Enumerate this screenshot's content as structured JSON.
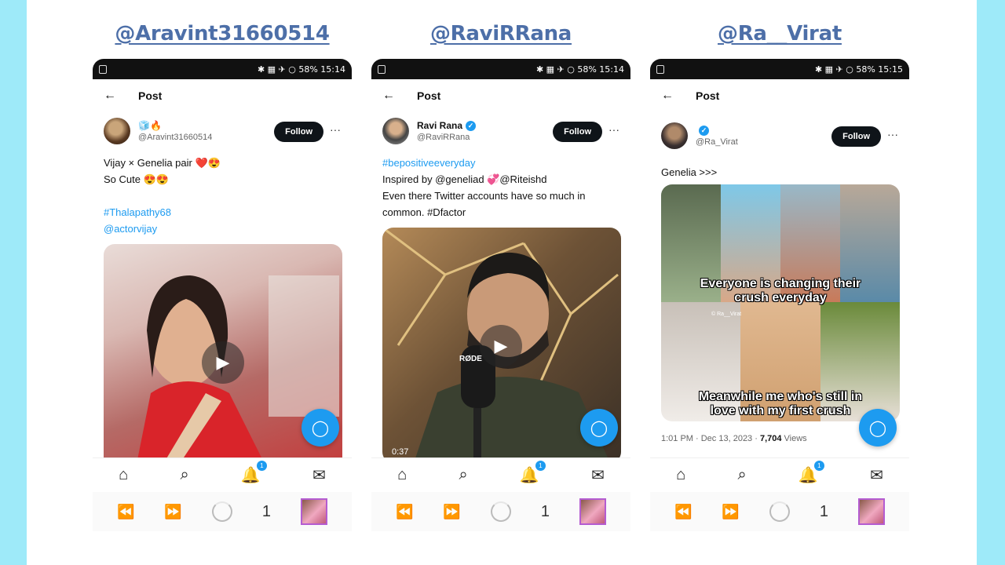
{
  "panels": [
    {
      "handle_title": "@Aravint31660514",
      "status": "✱ ▦ ✈ ○ 58% 15:14",
      "header": {
        "back": "←",
        "title": "Post"
      },
      "user": {
        "name": "🧊🔥",
        "handle": "@Aravint31660514",
        "verified": false
      },
      "follow_label": "Follow",
      "more": "···",
      "tweet_lines": [
        "Vijay × Genelia pair ❤️😍",
        "So Cute 😍😍",
        "",
        "#Thalapathy68",
        "@actorvijay"
      ],
      "nav": {
        "home": "⌂",
        "search": "⌕",
        "notifications": "🔔",
        "notif_count": "1",
        "messages": "✉"
      },
      "sys": {
        "rewind": "⏪",
        "forward": "⏩",
        "page": "1"
      }
    },
    {
      "handle_title": "@RaviRRana",
      "status": "✱ ▦ ✈ ○ 58% 15:14",
      "header": {
        "back": "←",
        "title": "Post"
      },
      "user": {
        "name": "Ravi Rana",
        "handle": "@RaviRRana",
        "verified": true
      },
      "follow_label": "Follow",
      "more": "···",
      "tweet_lines": [
        "#bepositiveeveryday",
        "Inspired by @geneliad 💞@Riteishd",
        "Even there Twitter accounts have so much in",
        "common. #Dfactor"
      ],
      "video_duration": "0:37",
      "mic_label": "RØDE",
      "nav": {
        "home": "⌂",
        "search": "⌕",
        "notifications": "🔔",
        "notif_count": "1",
        "messages": "✉"
      },
      "sys": {
        "rewind": "⏪",
        "forward": "⏩",
        "page": "1"
      }
    },
    {
      "handle_title": "@Ra__Virat",
      "status": "✱ ▦ ✈ ○ 58% 15:15",
      "header": {
        "back": "←",
        "title": "Post"
      },
      "user": {
        "name": "",
        "handle": "@Ra_Virat",
        "verified": true
      },
      "follow_label": "Follow",
      "more": "···",
      "tweet_lines": [
        "Genelia >>>"
      ],
      "meme": {
        "top_caption": [
          "Everyone is changing their",
          "crush everyday"
        ],
        "bottom_caption": [
          "Meanwhile me who's still in",
          "love with my first crush"
        ],
        "watermark": "© Ra__Virat"
      },
      "meta": {
        "time": "1:01 PM · Dec 13, 2023 · ",
        "views_count": "7,704",
        "views_label": " Views"
      },
      "nav": {
        "home": "⌂",
        "search": "⌕",
        "notifications": "🔔",
        "notif_count": "1",
        "messages": "✉"
      },
      "sys": {
        "rewind": "⏪",
        "forward": "⏩",
        "page": "1"
      }
    }
  ],
  "colors": {
    "side_bar": "#9eeaf9",
    "handle_title": "#4d6fa8",
    "twitter_blue": "#1d9bf0"
  }
}
